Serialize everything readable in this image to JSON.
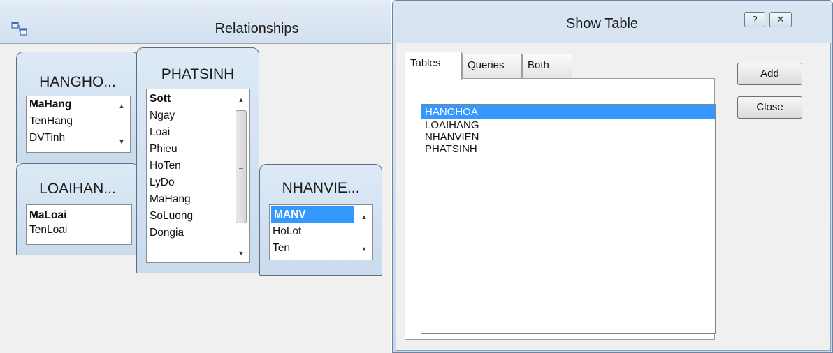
{
  "relationships": {
    "title": "Relationships",
    "icon": "relationships-icon",
    "tables": [
      {
        "title": "HANGHO...",
        "fields": [
          "MaHang",
          "TenHang",
          "DVTinh"
        ],
        "primary_key": "MaHang"
      },
      {
        "title": "PHATSINH",
        "fields": [
          "Sott",
          "Ngay",
          "Loai",
          "Phieu",
          "HoTen",
          "LyDo",
          "MaHang",
          "SoLuong",
          "Dongia"
        ],
        "primary_key": "Sott"
      },
      {
        "title": "LOAIHAN...",
        "fields": [
          "MaLoai",
          "TenLoai"
        ],
        "primary_key": "MaLoai"
      },
      {
        "title": "NHANVIE...",
        "fields": [
          "MANV",
          "HoLot",
          "Ten"
        ],
        "primary_key": "MANV",
        "selected": "MANV"
      }
    ]
  },
  "show_table": {
    "title": "Show Table",
    "help_label": "?",
    "close_label": "✕",
    "tabs": [
      "Tables",
      "Queries",
      "Both"
    ],
    "active_tab": "Tables",
    "items": [
      "HANGHOA",
      "LOAIHANG",
      "NHANVIEN",
      "PHATSINH"
    ],
    "selected_item": "HANGHOA",
    "add_label": "Add",
    "close_button_label": "Close"
  },
  "colors": {
    "selection": "#3399ff",
    "title_bar": "#d3e0ef"
  }
}
